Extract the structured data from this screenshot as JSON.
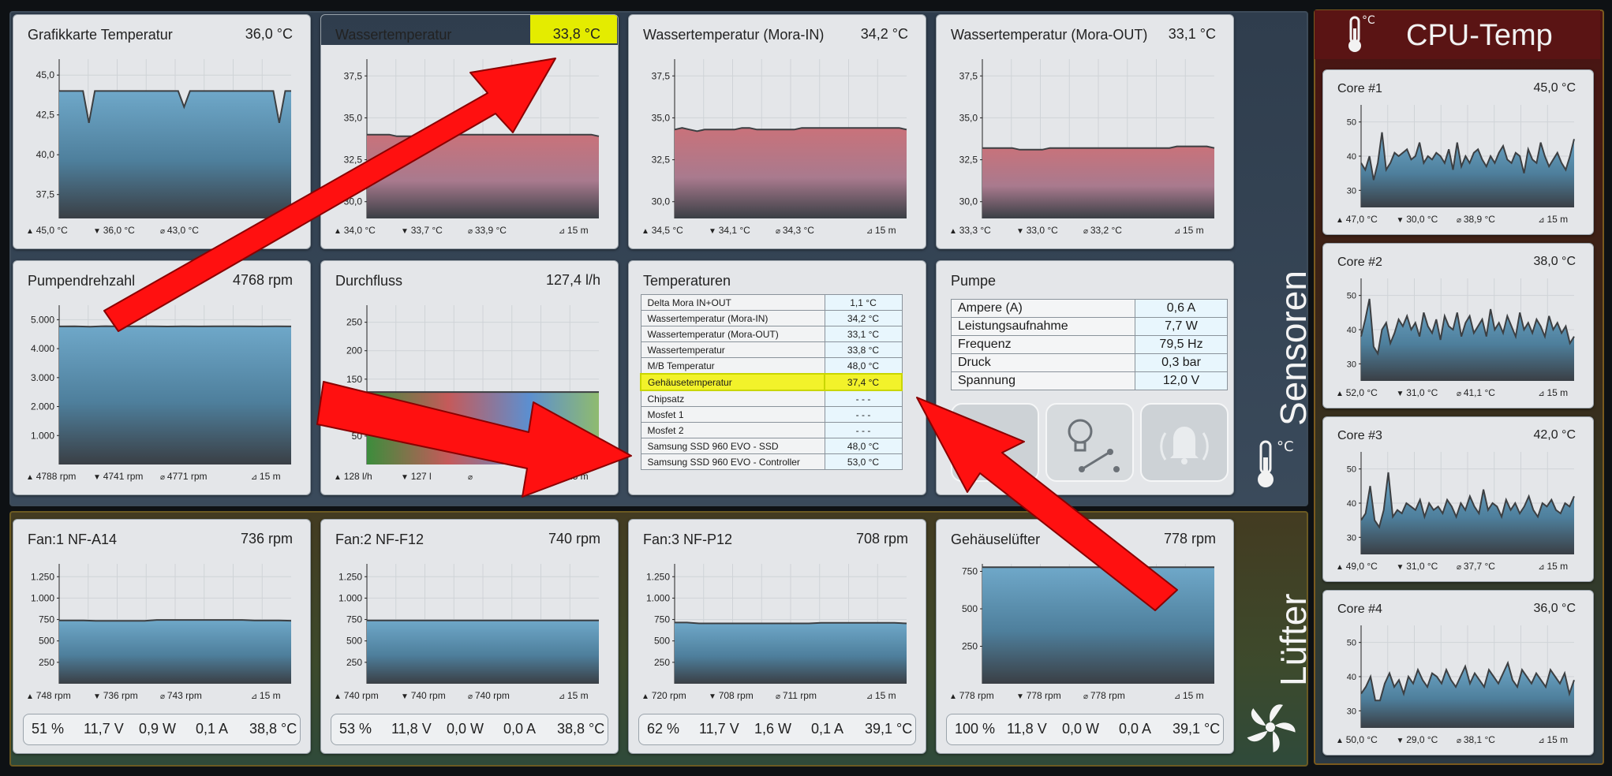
{
  "sections": {
    "sensors_label": "Sensoren",
    "fans_label": "Lüfter",
    "cpu_label": "CPU-Temp",
    "celsius_symbol": "°C"
  },
  "panels": {
    "gpu": {
      "title": "Grafikkarte Temperatur",
      "value": "36,0 °C",
      "stats": [
        "45,0 °C",
        "36,0 °C",
        "43,0 °C",
        ""
      ]
    },
    "water": {
      "title": "Wassertemperatur",
      "value": "33,8 °C",
      "stats": [
        "34,0 °C",
        "33,7 °C",
        "33,9 °C",
        "15 m"
      ]
    },
    "mora_in": {
      "title": "Wassertemperatur (Mora-IN)",
      "value": "34,2 °C",
      "stats": [
        "34,5 °C",
        "34,1 °C",
        "34,3 °C",
        "15 m"
      ]
    },
    "mora_out": {
      "title": "Wassertemperatur (Mora-OUT)",
      "value": "33,1 °C",
      "stats": [
        "33,3 °C",
        "33,0 °C",
        "33,2 °C",
        "15 m"
      ]
    },
    "pump_rpm": {
      "title": "Pumpendrehzahl",
      "value": "4768 rpm",
      "stats": [
        "4788 rpm",
        "4741 rpm",
        "4771 rpm",
        "15 m"
      ]
    },
    "flow": {
      "title": "Durchfluss",
      "value": "127,4 l/h",
      "stats": [
        "128 l/h",
        "127 l",
        "",
        "15 m"
      ]
    },
    "temps": {
      "title": "Temperaturen",
      "rows": [
        {
          "k": "Delta Mora IN+OUT",
          "v": "1,1 °C"
        },
        {
          "k": "Wassertemperatur (Mora-IN)",
          "v": "34,2 °C"
        },
        {
          "k": "Wassertemperatur (Mora-OUT)",
          "v": "33,1 °C"
        },
        {
          "k": "Wassertemperatur",
          "v": "33,8 °C"
        },
        {
          "k": "M/B Temperatur",
          "v": "48,0 °C"
        },
        {
          "k": "Gehäusetemperatur",
          "v": "37,4 °C"
        },
        {
          "k": "Chipsatz",
          "v": "- - -"
        },
        {
          "k": "Mosfet 1",
          "v": "- - -"
        },
        {
          "k": "Mosfet 2",
          "v": "- - -"
        },
        {
          "k": "Samsung SSD 960 EVO - SSD",
          "v": "48,0 °C"
        },
        {
          "k": "Samsung SSD 960 EVO - Controller",
          "v": "53,0 °C"
        }
      ]
    },
    "pump": {
      "title": "Pumpe",
      "rows": [
        {
          "k": "Ampere (A)",
          "v": "0,6 A"
        },
        {
          "k": "Leistungsaufnahme",
          "v": "7,7 W"
        },
        {
          "k": "Frequenz",
          "v": "79,5 Hz"
        },
        {
          "k": " Druck",
          "v": "0,3 bar"
        },
        {
          "k": " Spannung",
          "v": "12,0 V"
        }
      ]
    },
    "fan1": {
      "title": "Fan:1 NF-A14",
      "value": "736 rpm",
      "stats": [
        "748 rpm",
        "736 rpm",
        "743 rpm",
        "15 m"
      ],
      "foot": [
        "51 %",
        "11,7 V",
        "0,9 W",
        "0,1 A",
        "38,8 °C"
      ]
    },
    "fan2": {
      "title": "Fan:2 NF-F12",
      "value": "740 rpm",
      "stats": [
        "740 rpm",
        "740 rpm",
        "740 rpm",
        "15 m"
      ],
      "foot": [
        "53 %",
        "11,8 V",
        "0,0 W",
        "0,0 A",
        "38,8 °C"
      ]
    },
    "fan3": {
      "title": "Fan:3 NF-P12",
      "value": "708 rpm",
      "stats": [
        "720 rpm",
        "708 rpm",
        "711 rpm",
        "15 m"
      ],
      "foot": [
        "62 %",
        "11,7 V",
        "1,6 W",
        "0,1 A",
        "39,1 °C"
      ]
    },
    "case_fan": {
      "title": "Gehäuselüfter",
      "value": "778 rpm",
      "stats": [
        "778 rpm",
        "778 rpm",
        "778 rpm",
        "15 m"
      ],
      "foot": [
        "100 %",
        "11,8 V",
        "0,0 W",
        "0,0 A",
        "39,1 °C"
      ]
    },
    "core1": {
      "title": "Core #1",
      "value": "45,0 °C",
      "stats": [
        "47,0 °C",
        "30,0 °C",
        "38,9 °C",
        "15 m"
      ]
    },
    "core2": {
      "title": "Core #2",
      "value": "38,0 °C",
      "stats": [
        "52,0 °C",
        "31,0 °C",
        "41,1 °C",
        "15 m"
      ]
    },
    "core3": {
      "title": "Core #3",
      "value": "42,0 °C",
      "stats": [
        "49,0 °C",
        "31,0 °C",
        "37,7 °C",
        "15 m"
      ]
    },
    "core4": {
      "title": "Core #4",
      "value": "36,0 °C",
      "stats": [
        "50,0 °C",
        "29,0 °C",
        "38,1 °C",
        "15 m"
      ]
    }
  },
  "axes": {
    "gpu": [
      "45,0",
      "42,5",
      "40,0",
      "37,5"
    ],
    "water": [
      "37,5",
      "35,0",
      "32,5",
      "30,0"
    ],
    "mora_in": [
      "37,5",
      "35,0",
      "32,5",
      "30,0"
    ],
    "mora_out": [
      "37,5",
      "35,0",
      "32,5",
      "30,0"
    ],
    "pump_rpm": [
      "5.000",
      "4.000",
      "3.000",
      "2.000",
      "1.000"
    ],
    "flow": [
      "250",
      "200",
      "150",
      "100",
      "50"
    ],
    "fan1": [
      "1.250",
      "1.000",
      "750",
      "500",
      "250"
    ],
    "fan2": [
      "1.250",
      "1.000",
      "750",
      "500",
      "250"
    ],
    "fan3": [
      "1.250",
      "1.000",
      "750",
      "500",
      "250"
    ],
    "case_fan": [
      "750",
      "500",
      "250"
    ],
    "core": [
      "50",
      "40",
      "30"
    ]
  },
  "series": {
    "gpu": [
      44,
      44,
      44,
      44,
      44,
      42,
      44,
      44,
      44,
      44,
      44,
      44,
      44,
      44,
      44,
      44,
      44,
      44,
      44,
      44,
      44,
      43,
      44,
      44,
      44,
      44,
      44,
      44,
      44,
      44,
      44,
      44,
      44,
      44,
      44,
      44,
      44,
      42,
      44,
      44
    ],
    "water": [
      34,
      34,
      34,
      34,
      33.9,
      33.9,
      33.9,
      33.9,
      33.9,
      33.9,
      33.9,
      33.9,
      34,
      34,
      34,
      34,
      34,
      34,
      34,
      34,
      34,
      34,
      34,
      34,
      34,
      34,
      34,
      34,
      34,
      34,
      34,
      33.9
    ],
    "mora_in": [
      34.3,
      34.4,
      34.3,
      34.2,
      34.3,
      34.3,
      34.3,
      34.3,
      34.3,
      34.4,
      34.4,
      34.3,
      34.3,
      34.3,
      34.3,
      34.3,
      34.3,
      34.4,
      34.4,
      34.4,
      34.4,
      34.4,
      34.4,
      34.4,
      34.4,
      34.4,
      34.4,
      34.4,
      34.4,
      34.4,
      34.4,
      34.3
    ],
    "mora_out": [
      33.2,
      33.2,
      33.2,
      33.2,
      33.2,
      33.1,
      33.1,
      33.1,
      33.1,
      33.2,
      33.2,
      33.2,
      33.2,
      33.2,
      33.2,
      33.2,
      33.2,
      33.2,
      33.2,
      33.2,
      33.2,
      33.2,
      33.2,
      33.2,
      33.2,
      33.2,
      33.3,
      33.3,
      33.3,
      33.3,
      33.3,
      33.2
    ],
    "pump_rpm": [
      4768,
      4770,
      4760,
      4775,
      4768,
      4770,
      4772,
      4765,
      4770,
      4768,
      4771,
      4769,
      4770,
      4768,
      4772,
      4768
    ],
    "flow": [
      127.4,
      127.4,
      127.4,
      127.4,
      127.4,
      127.4,
      127.4,
      127.4,
      127.4,
      127.4
    ],
    "fan1": [
      740,
      740,
      740,
      735,
      735,
      735,
      735,
      735,
      745,
      745,
      745,
      745,
      745,
      745,
      745,
      745,
      740,
      740,
      740,
      736
    ],
    "fan2": [
      740,
      740,
      740,
      740,
      740,
      740,
      740,
      740,
      740,
      740,
      740,
      740,
      740,
      740,
      740,
      740,
      740,
      740,
      740,
      740
    ],
    "fan3": [
      715,
      715,
      705,
      705,
      705,
      705,
      705,
      705,
      705,
      705,
      705,
      705,
      712,
      712,
      712,
      712,
      712,
      712,
      712,
      705
    ],
    "case_fan": [
      778,
      778,
      778,
      778,
      778,
      778,
      778,
      778,
      778,
      778,
      778,
      778,
      778,
      778,
      778,
      778,
      778,
      778,
      778,
      778
    ],
    "core1": [
      38,
      36,
      40,
      33,
      38,
      47,
      36,
      38,
      41,
      40,
      41,
      42,
      39,
      40,
      44,
      38,
      40,
      39,
      41,
      40,
      38,
      42,
      36,
      44,
      37,
      40,
      38,
      41,
      42,
      39,
      37,
      40,
      38,
      41,
      43,
      39,
      38,
      41,
      40,
      35,
      42,
      39,
      38,
      44,
      40,
      37,
      39,
      41,
      38,
      36,
      40,
      45
    ],
    "core2": [
      38,
      43,
      49,
      35,
      33,
      40,
      42,
      36,
      39,
      43,
      41,
      44,
      40,
      42,
      38,
      45,
      41,
      39,
      43,
      37,
      44,
      41,
      40,
      45,
      38,
      42,
      44,
      39,
      41,
      43,
      38,
      46,
      40,
      42,
      39,
      44,
      41,
      38,
      45,
      40,
      42,
      39,
      43,
      41,
      38,
      44,
      40,
      42,
      39,
      41,
      36,
      38
    ],
    "core3": [
      35,
      37,
      45,
      35,
      33,
      38,
      49,
      36,
      38,
      37,
      40,
      39,
      38,
      41,
      36,
      40,
      38,
      39,
      37,
      41,
      39,
      36,
      40,
      38,
      42,
      39,
      37,
      44,
      38,
      40,
      39,
      36,
      41,
      38,
      40,
      37,
      39,
      42,
      38,
      36,
      40,
      39,
      41,
      38,
      37,
      40,
      39,
      42
    ],
    "core4": [
      35,
      37,
      40,
      33,
      33,
      38,
      41,
      37,
      39,
      35,
      40,
      38,
      42,
      39,
      37,
      41,
      40,
      38,
      42,
      39,
      37,
      40,
      43,
      38,
      41,
      39,
      37,
      42,
      40,
      38,
      41,
      44,
      39,
      37,
      42,
      40,
      38,
      41,
      39,
      37,
      42,
      40,
      38,
      41,
      35,
      39
    ]
  },
  "colors": {
    "chart_blue_top": "#6fa8c9",
    "chart_red_top": "#c9727a",
    "chart_bottom": "#3a3f45",
    "highlight": "#e4ec00",
    "annotation_arrow": "#ff1010"
  },
  "stat_icons": [
    "max-icon",
    "min-icon",
    "avg-icon",
    "timespan-icon"
  ]
}
